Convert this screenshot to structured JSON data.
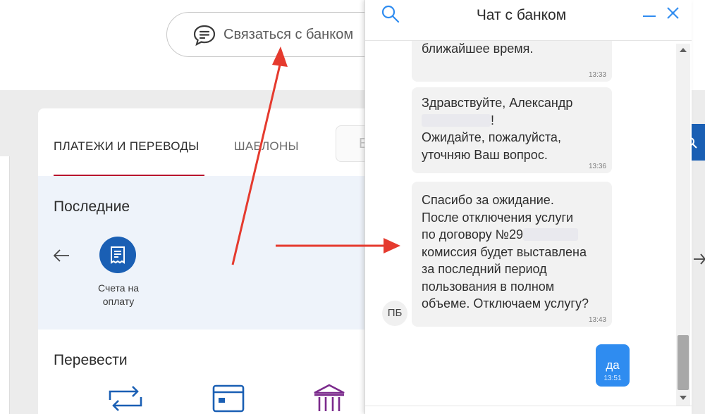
{
  "header": {
    "contact_bank_label": "Связаться с банком",
    "contact_icon": "chat-bubble-icon"
  },
  "card": {
    "tabs": [
      {
        "label": "ПЛАТЕЖИ И ПЕРЕВОДЫ",
        "active": true
      },
      {
        "label": "ШАБЛОНЫ",
        "active": false
      }
    ],
    "partial_tab_letter": "Е",
    "accent_color": "#b8102e",
    "recent": {
      "title": "Последние",
      "items": [
        {
          "label": "Счета на оплату",
          "icon": "invoice-icon"
        }
      ]
    },
    "transfer": {
      "title": "Перевести",
      "icons": [
        "swap-arrows-icon",
        "card-icon",
        "bank-building-icon"
      ]
    }
  },
  "chat": {
    "title": "Чат с банком",
    "messages": [
      {
        "from": "bank",
        "text": "специалист ответит Вам в\nближайшее время.",
        "time": "13:33"
      },
      {
        "from": "bank",
        "text_before": "Здравствуйте, Александр",
        "text_after": "Ожидайте, пожалуйста,\nуточняю Ваш вопрос.",
        "time": "13:36"
      },
      {
        "from": "bank",
        "text": "Спасибо за ожидание.\nПосле отключения услуги\nпо договору №29",
        "text_after": "комиссия будет выставлена\nза последний период\nпользования в полном\nобъеме. Отключаем услугу?",
        "time": "13:43",
        "avatar": "ПБ"
      },
      {
        "from": "user",
        "text": "да",
        "time": "13:51"
      }
    ],
    "colors": {
      "user_bubble": "#2f8cf0",
      "bank_bubble": "#f2f2f2"
    }
  },
  "annotation_color": "#e53a2e"
}
